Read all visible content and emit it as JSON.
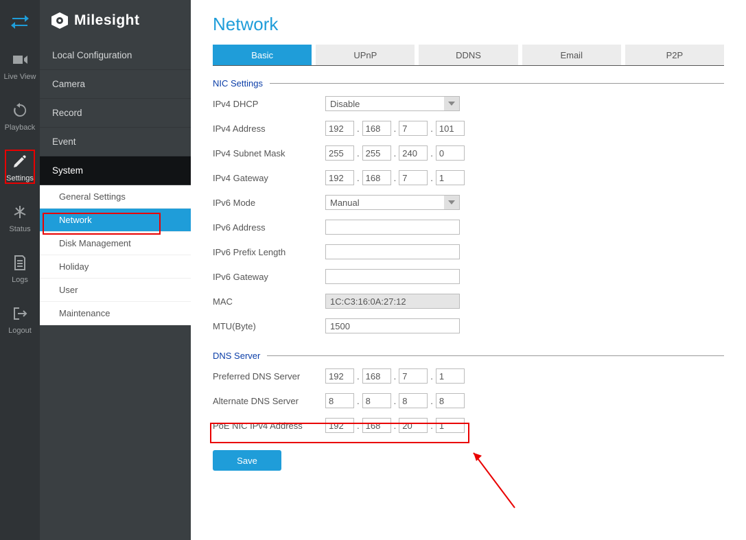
{
  "rail": {
    "items": [
      {
        "name": "live-view",
        "label": "Live View"
      },
      {
        "name": "playback",
        "label": "Playback"
      },
      {
        "name": "settings",
        "label": "Settings"
      },
      {
        "name": "status",
        "label": "Status"
      },
      {
        "name": "logs",
        "label": "Logs"
      },
      {
        "name": "logout",
        "label": "Logout"
      }
    ]
  },
  "brand": "Milesight",
  "sidebar": {
    "items": [
      {
        "label": "Local Configuration"
      },
      {
        "label": "Camera"
      },
      {
        "label": "Record"
      },
      {
        "label": "Event"
      },
      {
        "label": "System"
      }
    ],
    "subs": [
      {
        "label": "General Settings"
      },
      {
        "label": "Network"
      },
      {
        "label": "Disk Management"
      },
      {
        "label": "Holiday"
      },
      {
        "label": "User"
      },
      {
        "label": "Maintenance"
      }
    ]
  },
  "page": {
    "title": "Network",
    "tabs": [
      {
        "label": "Basic"
      },
      {
        "label": "UPnP"
      },
      {
        "label": "DDNS"
      },
      {
        "label": "Email"
      },
      {
        "label": "P2P"
      }
    ],
    "sections": {
      "nic": "NIC Settings",
      "dns": "DNS Server"
    },
    "fields": {
      "ipv4_dhcp": {
        "label": "IPv4 DHCP",
        "value": "Disable"
      },
      "ipv4_addr": {
        "label": "IPv4 Address",
        "value": [
          "192",
          "168",
          "7",
          "101"
        ]
      },
      "ipv4_mask": {
        "label": "IPv4 Subnet Mask",
        "value": [
          "255",
          "255",
          "240",
          "0"
        ]
      },
      "ipv4_gw": {
        "label": "IPv4 Gateway",
        "value": [
          "192",
          "168",
          "7",
          "1"
        ]
      },
      "ipv6_mode": {
        "label": "IPv6 Mode",
        "value": "Manual"
      },
      "ipv6_addr": {
        "label": "IPv6 Address",
        "value": ""
      },
      "ipv6_prefix": {
        "label": "IPv6 Prefix Length",
        "value": ""
      },
      "ipv6_gw": {
        "label": "IPv6 Gateway",
        "value": ""
      },
      "mac": {
        "label": "MAC",
        "value": "1C:C3:16:0A:27:12"
      },
      "mtu": {
        "label": "MTU(Byte)",
        "value": "1500"
      },
      "dns_pref": {
        "label": "Preferred DNS Server",
        "value": [
          "192",
          "168",
          "7",
          "1"
        ]
      },
      "dns_alt": {
        "label": "Alternate DNS Server",
        "value": [
          "8",
          "8",
          "8",
          "8"
        ]
      },
      "poe_nic": {
        "label": "PoE NIC IPv4 Address",
        "value": [
          "192",
          "168",
          "20",
          "1"
        ]
      }
    },
    "save": "Save"
  }
}
